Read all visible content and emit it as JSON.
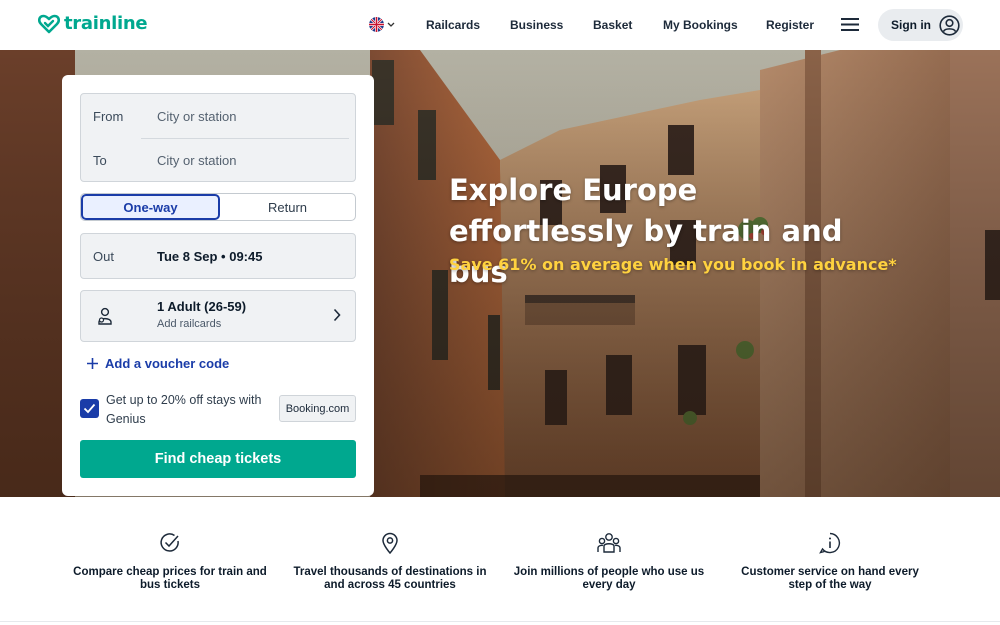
{
  "header": {
    "logo_text": "trainline",
    "language": "English (UK)",
    "nav": [
      "Railcards",
      "Business",
      "Basket",
      "My Bookings",
      "Register"
    ],
    "signin_label": "Sign in"
  },
  "hero": {
    "title": "Explore Europe effortlessly by train and bus",
    "subtitle": "Save 61% on average when you book in advance*"
  },
  "search": {
    "from_label": "From",
    "from_placeholder": "City or station",
    "to_label": "To",
    "to_placeholder": "City or station",
    "trip_types": [
      "One-way",
      "Return"
    ],
    "selected_trip": "One-way",
    "out_label": "Out",
    "out_value": "Tue 8 Sep • 09:45",
    "passengers": "1 Adult (26-59)",
    "railcards": "Add railcards",
    "voucher": "Add a voucher code",
    "genius_text": "Get up to 20% off stays with Genius",
    "genius_checked": true,
    "partner": "Booking.com",
    "cta": "Find cheap tickets"
  },
  "features": [
    {
      "icon": "check-badge-icon",
      "text": "Compare cheap prices for train and bus tickets"
    },
    {
      "icon": "map-pin-icon",
      "text": "Travel thousands of destinations in and across 45 countries"
    },
    {
      "icon": "people-icon",
      "text": "Join millions of people who use us every day"
    },
    {
      "icon": "info-icon",
      "text": "Customer service on hand every step of the way"
    }
  ],
  "colors": {
    "brand": "#00a88f",
    "accent": "#1a3ca8",
    "highlight": "#ffd23f"
  }
}
